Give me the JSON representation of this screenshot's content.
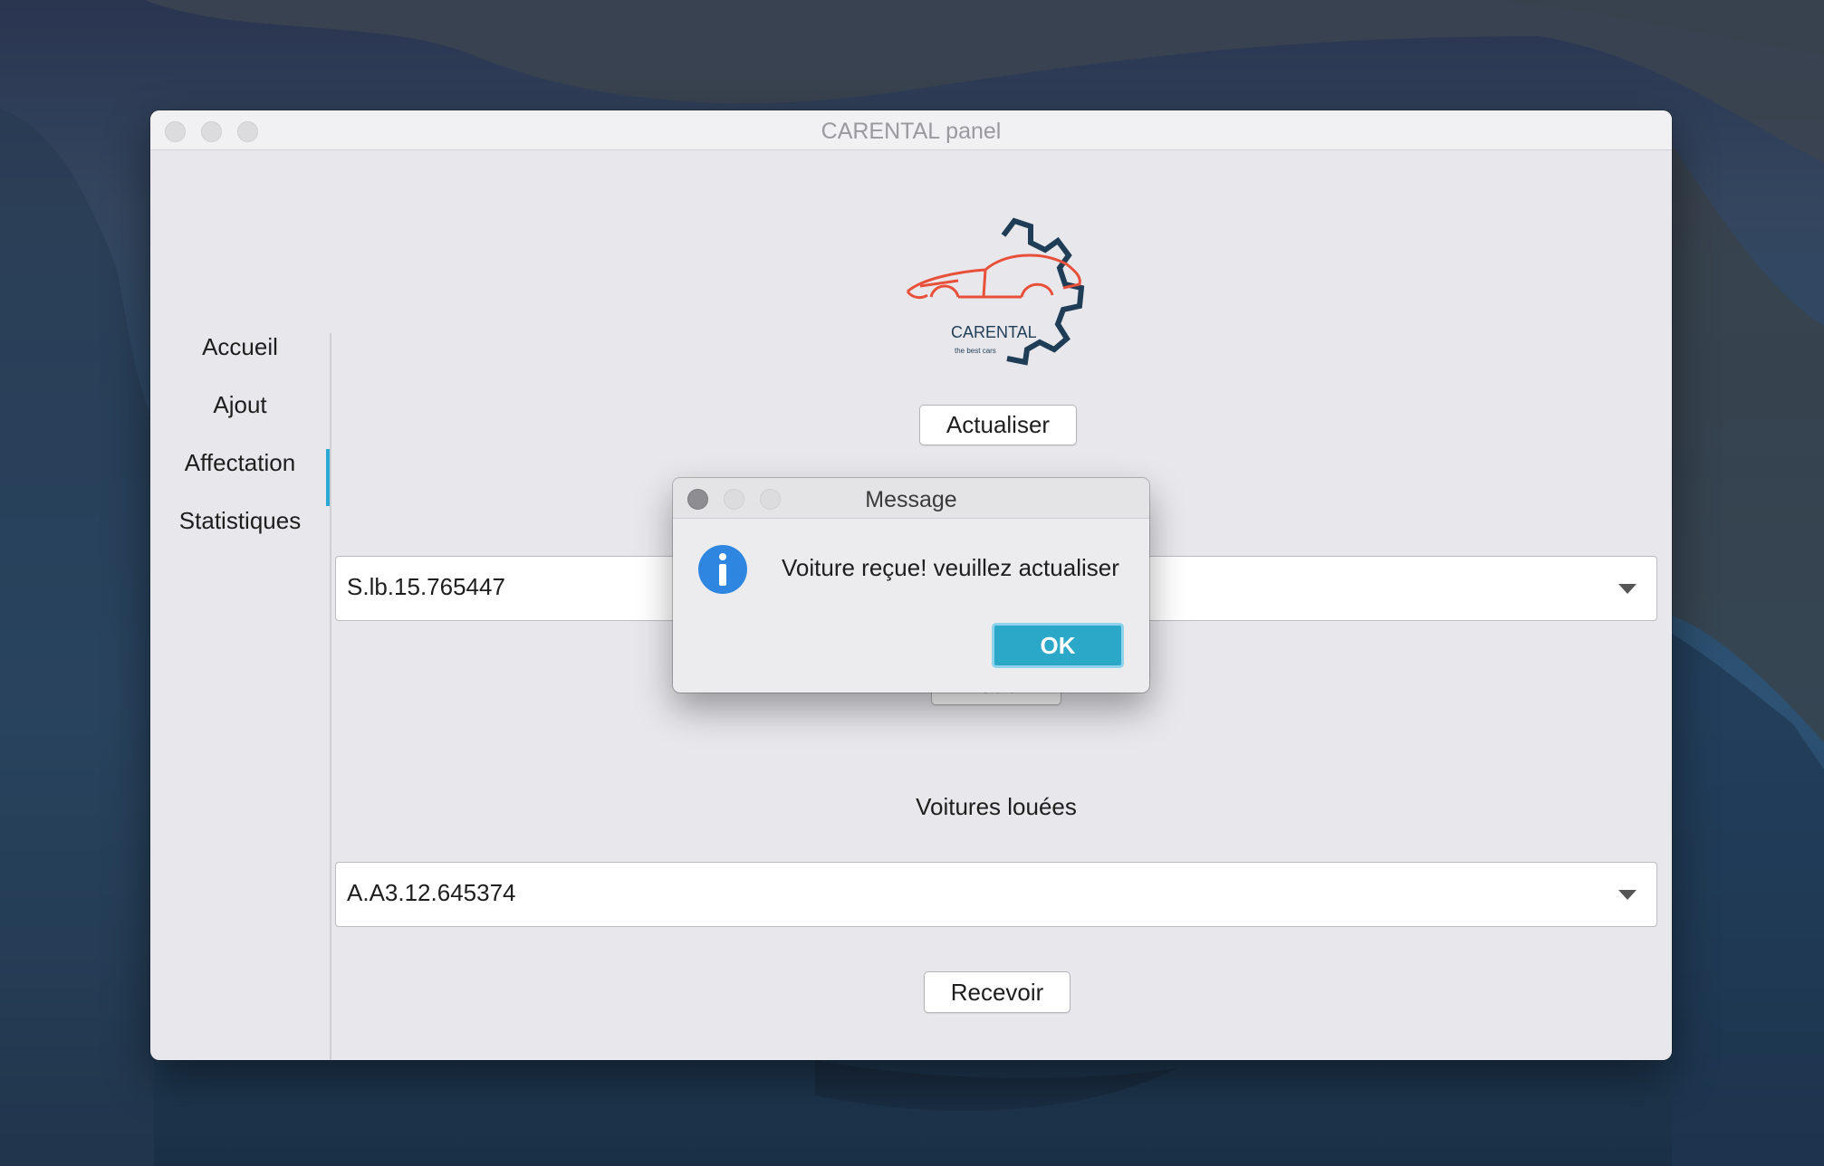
{
  "window": {
    "title": "CARENTAL panel"
  },
  "sidebar": {
    "items": [
      {
        "label": "Accueil"
      },
      {
        "label": "Ajout"
      },
      {
        "label": "Affectation"
      },
      {
        "label": "Statistiques"
      }
    ],
    "active": "Affectation"
  },
  "logo": {
    "brand": "CARENTAL",
    "tagline": "the best cars"
  },
  "main": {
    "refresh_label": "Actualiser",
    "available_select": {
      "value": "S.lb.15.765447"
    },
    "rent_label": "Louer",
    "rented_title": "Voitures louées",
    "rented_select": {
      "value": "A.A3.12.645374"
    },
    "receive_label": "Recevoir"
  },
  "dialog": {
    "title": "Message",
    "message": "Voiture reçue! veuillez actualiser",
    "ok_label": "OK",
    "icon": "info-icon"
  },
  "colors": {
    "accent": "#29a9d3",
    "ok_button": "#2ba7c8",
    "logo_car": "#e8503a",
    "logo_gear": "#1f3d57"
  }
}
